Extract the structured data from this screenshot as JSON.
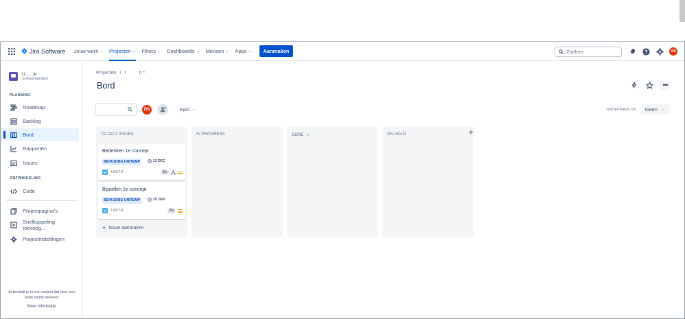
{
  "topnav": {
    "logo_text": "Jira Software",
    "items": [
      {
        "label": "Jouw werk",
        "active": false
      },
      {
        "label": "Projecten",
        "active": true
      },
      {
        "label": "Filters",
        "active": false
      },
      {
        "label": "Dashboards",
        "active": false
      },
      {
        "label": "Mensen",
        "active": false
      },
      {
        "label": "Apps",
        "active": false
      }
    ],
    "create_label": "Aanmaken",
    "search_placeholder": "Zoeken",
    "user_initials": "DS"
  },
  "sidebar": {
    "project_name": "U... ...k",
    "project_type": "Softwareproject",
    "planning_title": "PLANNING",
    "planning_items": [
      {
        "label": "Roadmap",
        "icon": "roadmap-icon"
      },
      {
        "label": "Backlog",
        "icon": "backlog-icon"
      },
      {
        "label": "Bord",
        "icon": "board-icon",
        "selected": true
      },
      {
        "label": "Rapporten",
        "icon": "reports-icon"
      },
      {
        "label": "Issues",
        "icon": "issues-icon"
      }
    ],
    "dev_title": "ONTWIKKELING",
    "dev_items": [
      {
        "label": "Code",
        "icon": "code-icon"
      }
    ],
    "other_items": [
      {
        "label": "Projectpagina's",
        "icon": "pages-icon"
      },
      {
        "label": "Snelkoppeling toevoeg...",
        "icon": "shortcut-icon"
      },
      {
        "label": "Projectinstellingen",
        "icon": "settings-icon"
      }
    ],
    "footer_line1": "Je bevindt je in een project dat door een",
    "footer_line2": "team wordt beheerd",
    "more_info": "Meer informatie"
  },
  "main": {
    "breadcrumb_root": "Projecten",
    "breadcrumb_sep": "/",
    "breadcrumb_project": "l          n *",
    "title": "Bord",
    "epic_label": "Epic",
    "group_by_label": "GROEPEREN OP",
    "group_by_value": "Geen",
    "user_initials": "DS"
  },
  "columns": [
    {
      "title": "TO DO 2 ISSUES",
      "done_check": false
    },
    {
      "title": "IN PROGRESS",
      "done_check": false
    },
    {
      "title": "DONE",
      "done_check": true
    },
    {
      "title": "ON HOLD",
      "done_check": false
    }
  ],
  "cards": [
    {
      "title": "Bedenken 1e concept",
      "epic": "BEHUIZING UNITEMP",
      "due": "12 DEC",
      "key": "UNIT-2",
      "estimate": "2w",
      "has_subtask_icon": true
    },
    {
      "title": "Bijstellen 1e concept",
      "epic": "BEHUIZING UNITEMP",
      "due": "29 JAN",
      "key": "UNIT-4",
      "estimate": "2w",
      "has_subtask_icon": false
    }
  ],
  "create_issue_label": "Issue aanmaken",
  "colors": {
    "primary": "#0052cc",
    "avatar": "#de350b",
    "project_avatar": "#5e4db2",
    "task": "#4bade8",
    "priority": "#ffab00"
  }
}
